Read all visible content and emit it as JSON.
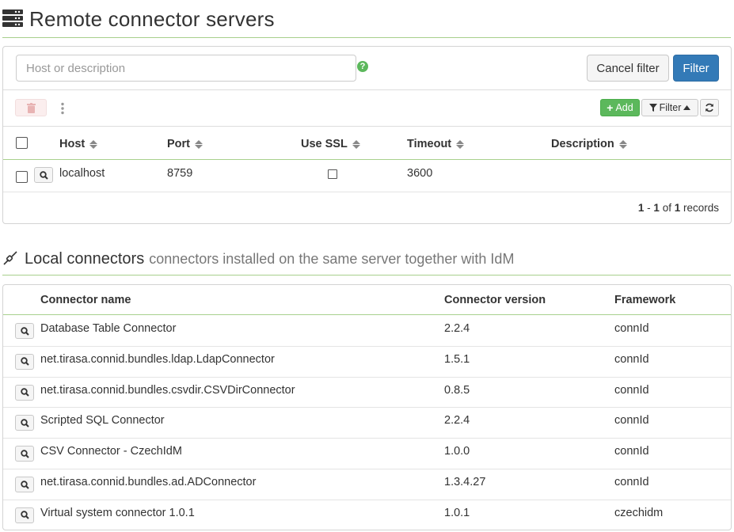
{
  "remote": {
    "title": "Remote connector servers",
    "filter": {
      "placeholder": "Host or description",
      "help_icon": "?",
      "cancel_label": "Cancel filter",
      "filter_label": "Filter"
    },
    "toolbar": {
      "add_label": "Add",
      "filter_toggle_label": "Filter"
    },
    "columns": [
      "Host",
      "Port",
      "Use SSL",
      "Timeout",
      "Description"
    ],
    "rows": [
      {
        "host": "localhost",
        "port": "8759",
        "use_ssl": false,
        "timeout": "3600",
        "description": ""
      }
    ],
    "pagination": {
      "from": "1",
      "sep": " - ",
      "to": "1",
      "of": " of ",
      "total": "1",
      "suffix": " records"
    }
  },
  "local": {
    "title": "Local connectors",
    "subtitle": "connectors installed on the same server together with IdM",
    "columns": [
      "Connector name",
      "Connector version",
      "Framework"
    ],
    "rows": [
      {
        "name": "Database Table Connector",
        "version": "2.2.4",
        "framework": "connId"
      },
      {
        "name": "net.tirasa.connid.bundles.ldap.LdapConnector",
        "version": "1.5.1",
        "framework": "connId"
      },
      {
        "name": "net.tirasa.connid.bundles.csvdir.CSVDirConnector",
        "version": "0.8.5",
        "framework": "connId"
      },
      {
        "name": "Scripted SQL Connector",
        "version": "2.2.4",
        "framework": "connId"
      },
      {
        "name": "CSV Connector - CzechIdM",
        "version": "1.0.0",
        "framework": "connId"
      },
      {
        "name": "net.tirasa.connid.bundles.ad.ADConnector",
        "version": "1.3.4.27",
        "framework": "connId"
      },
      {
        "name": "Virtual system connector 1.0.1",
        "version": "1.0.1",
        "framework": "czechidm"
      }
    ]
  },
  "colors": {
    "accent_green": "#5cb85c",
    "primary_blue": "#337ab7",
    "divider_green": "#a8d08d"
  }
}
